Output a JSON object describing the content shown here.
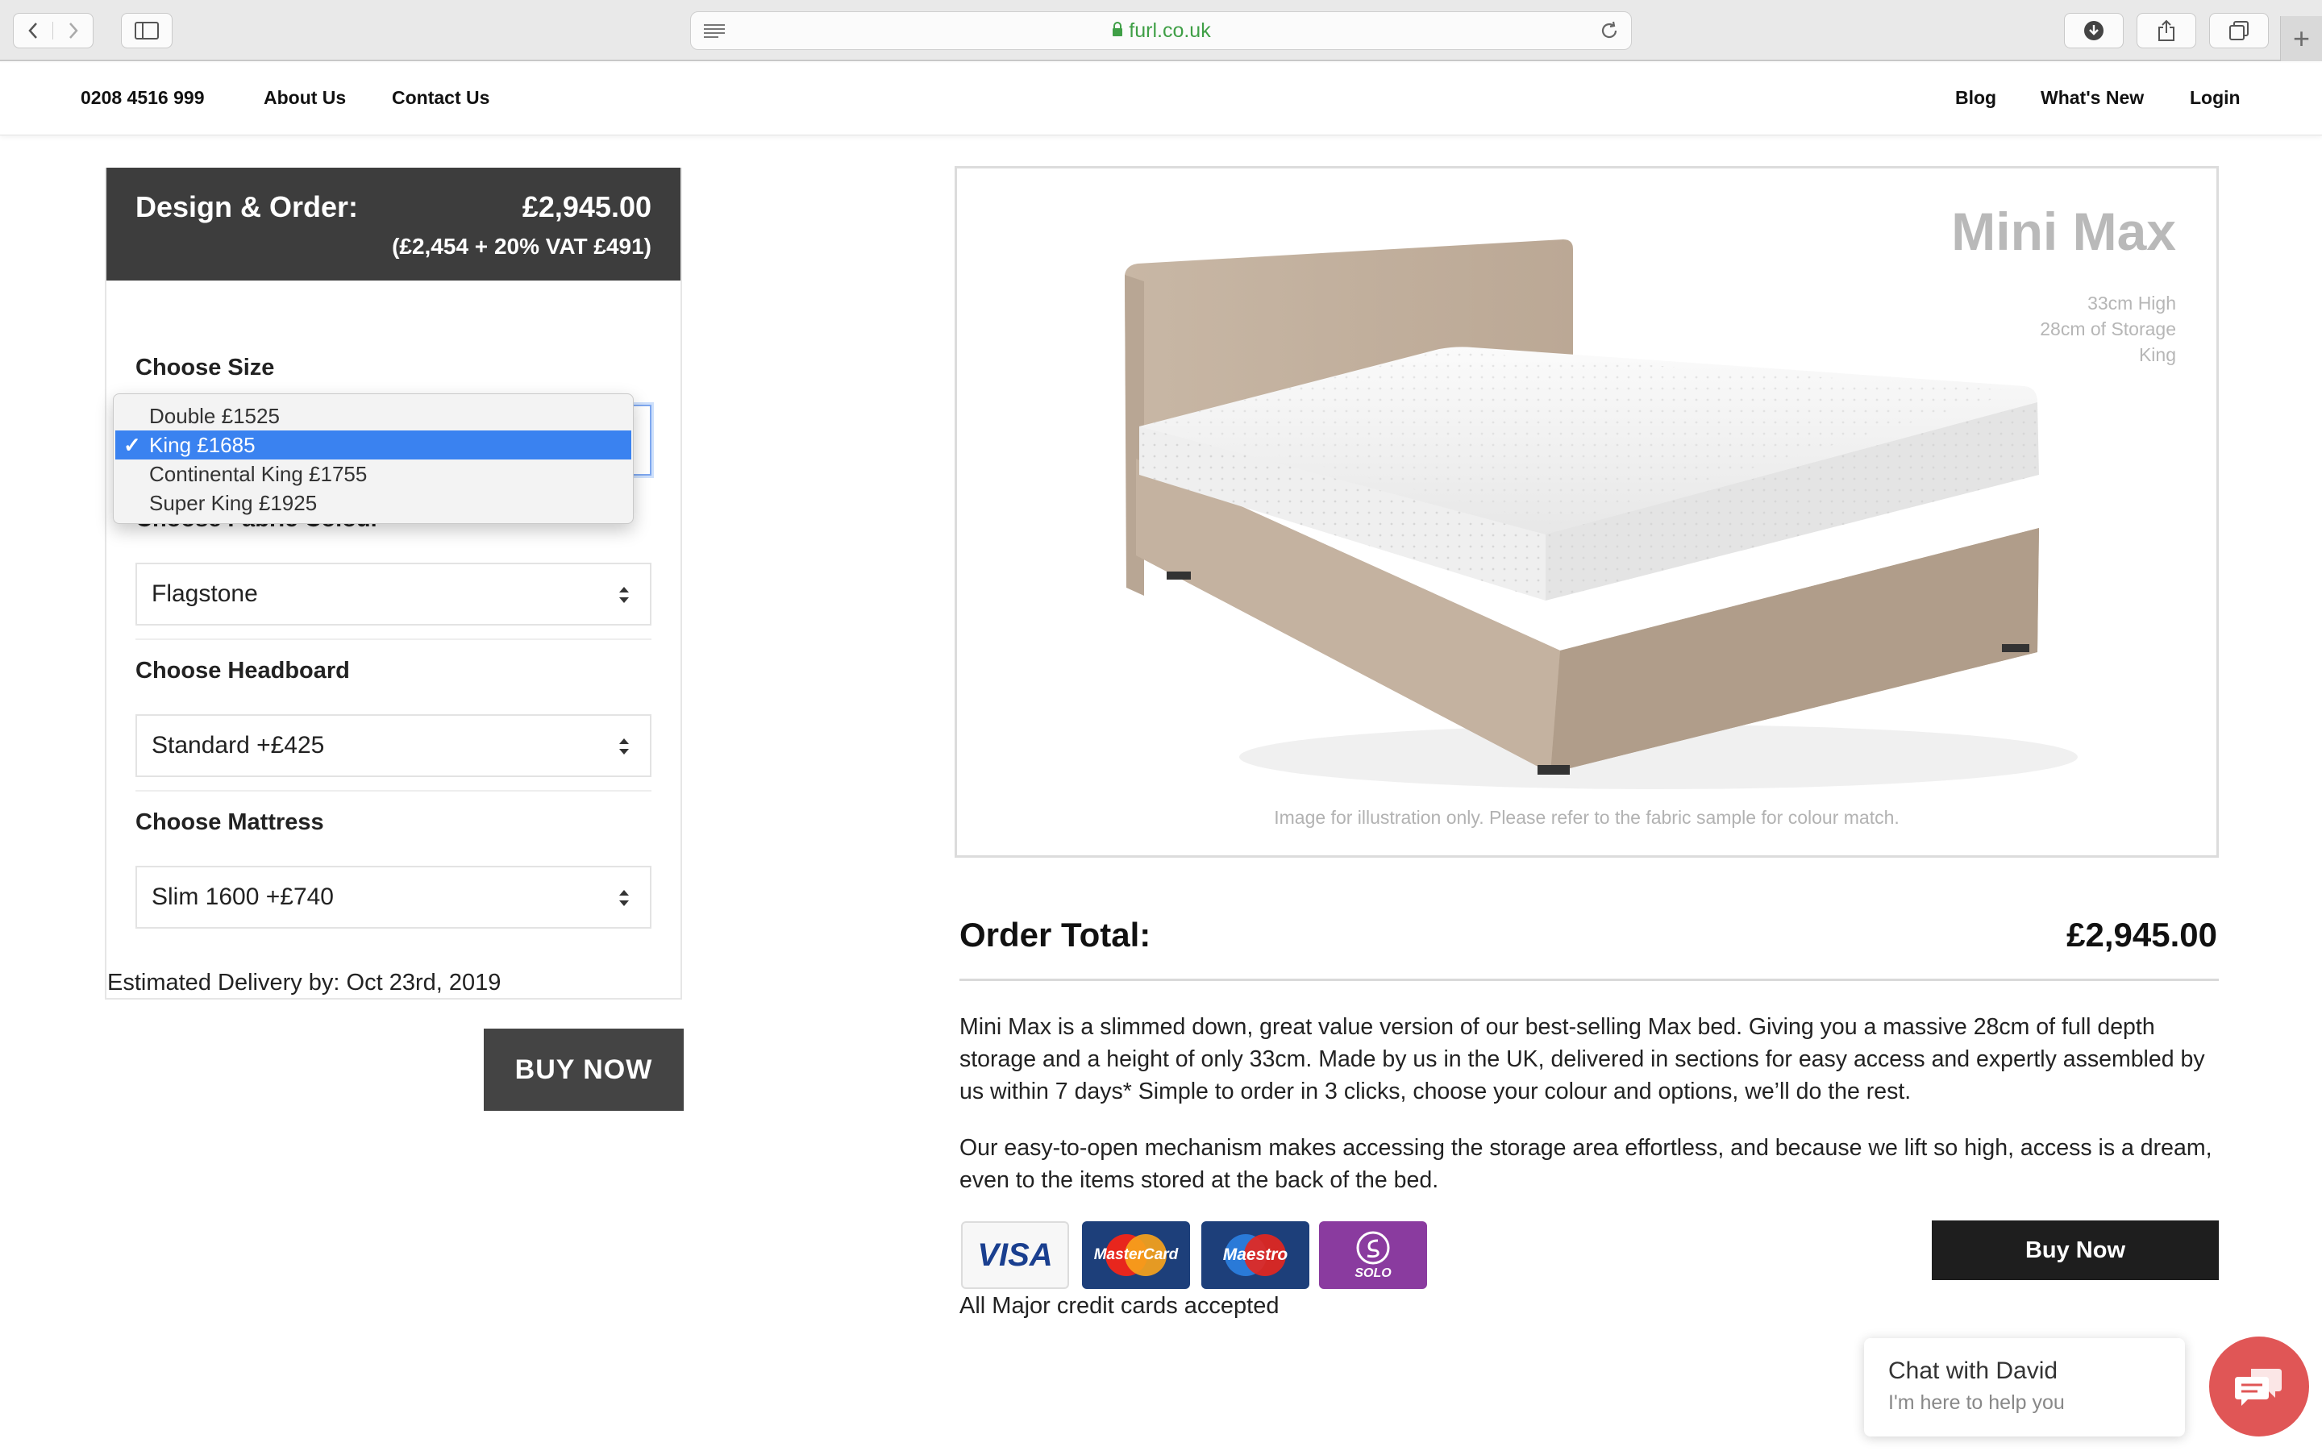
{
  "browser": {
    "url": "furl.co.uk",
    "new_tab_label": "+"
  },
  "nav": {
    "phone": "0208 4516 999",
    "about": "About Us",
    "contact": "Contact Us",
    "blog": "Blog",
    "whats_new": "What's New",
    "login": "Login"
  },
  "order_panel": {
    "title": "Design & Order:",
    "price": "£2,945.00",
    "vat_breakdown": "(£2,454 + 20% VAT £491)",
    "size_label": "Choose Size",
    "fabric_label": "Choose Fabric Colour",
    "fabric_value": "Flagstone",
    "headboard_label": "Choose Headboard",
    "headboard_value": "Standard  +£425",
    "mattress_label": "Choose Mattress",
    "mattress_value": "Slim 1600  +£740",
    "delivery": "Estimated Delivery by: Oct 23rd, 2019",
    "buy_label": "BUY NOW"
  },
  "size_dropdown": {
    "selected_index": 1,
    "checkmark": "✓",
    "options": [
      {
        "label": "Double  £1525"
      },
      {
        "label": "King  £1685"
      },
      {
        "label": "Continental King  £1755"
      },
      {
        "label": "Super King  £1925"
      }
    ]
  },
  "product": {
    "name": "Mini Max",
    "specs": [
      "33cm High",
      "28cm of Storage",
      "King"
    ],
    "image_caption": "Image for illustration only. Please refer to the fabric sample for colour match."
  },
  "order_total": {
    "label": "Order Total:",
    "value": "£2,945.00"
  },
  "description": [
    "Mini Max is a slimmed down, great value version of our best-selling Max bed. Giving you a massive 28cm of full depth storage and a height of only 33cm. Made by us in the UK, delivered in sections for easy access and expertly assembled by us within 7 days* Simple to order in 3 clicks, choose your colour and options, we’ll do the rest.",
    "Our easy-to-open mechanism makes accessing the storage area effortless, and because we lift so high, access is a dream, even to the items stored at the back of the bed."
  ],
  "payment": {
    "cards": [
      "VISA",
      "MasterCard",
      "Maestro",
      "SOLO"
    ],
    "note": "All Major credit cards accepted",
    "buy_label": "Buy Now"
  },
  "chat": {
    "title": "Chat with David",
    "subtitle": "I'm here to help you"
  },
  "colors": {
    "panel_header": "#3d3d3d",
    "dropdown_highlight": "#3a82f0",
    "chat_button": "#e05656",
    "url_green": "#3f9f46"
  }
}
